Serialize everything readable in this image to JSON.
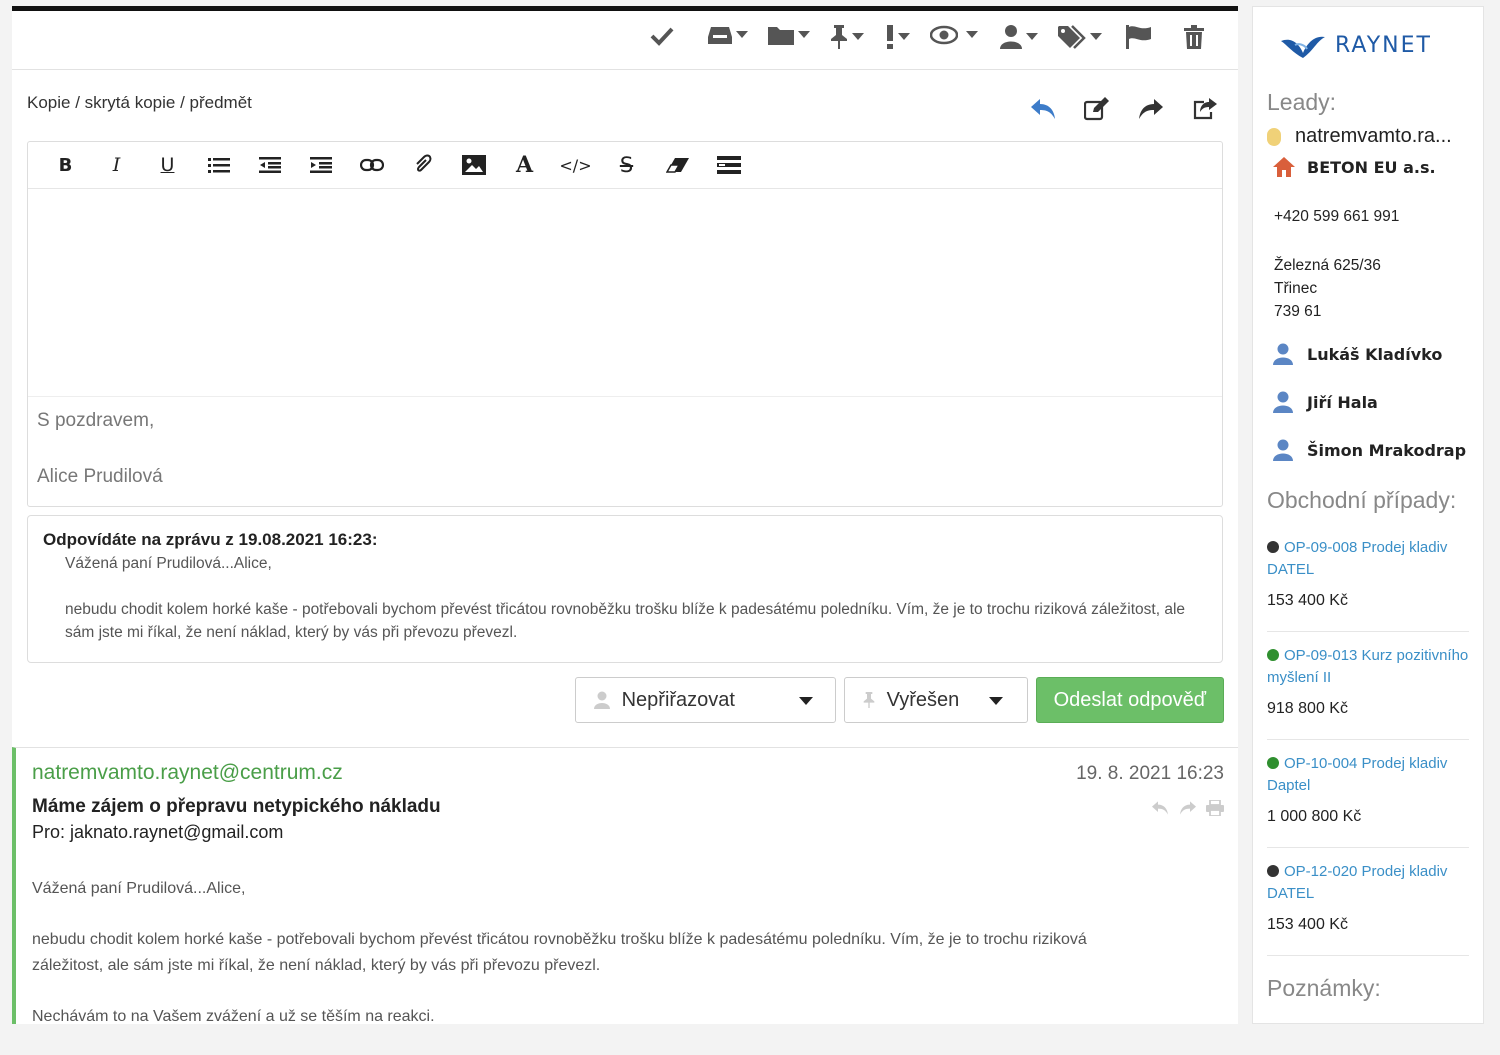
{
  "compose": {
    "recipients_label": "Kopie / skrytá kopie / předmět",
    "signature_line1": "S pozdravem,",
    "signature_line2": "Alice Prudilová"
  },
  "quote": {
    "title": "Odpovídáte na zprávu z 19.08.2021 16:23:",
    "greeting": "Vážená paní Prudilová...Alice,",
    "body": "nebudu chodit kolem horké kaše - potřebovali bychom převést třicátou rovnoběžku trošku blíže k padesátému poledníku. Vím, že je to trochu riziková záležitost, ale sám jste mi říkal, že není náklad, který by vás při převozu převezl."
  },
  "buttons": {
    "assign": "Nepřiřazovat",
    "status": "Vyřešen",
    "send": "Odeslat odpověď"
  },
  "message": {
    "from": "natremvamto.raynet@centrum.cz",
    "date": "19. 8. 2021 16:23",
    "subject": "Máme zájem o přepravu netypického nákladu",
    "to": "Pro: jaknato.raynet@gmail.com",
    "greeting": "Vážená paní Prudilová...Alice,",
    "body": "nebudu chodit kolem horké kaše - potřebovali bychom převést třicátou rovnoběžku trošku blíže k padesátému poledníku. Vím, že je to trochu riziková záležitost, ale sám jste mi říkal, že není náklad, který by vás při převozu převezl.",
    "closing": "Nechávám to na Vašem zvážení a už se těším na reakci."
  },
  "sidebar": {
    "logo": "RAYNET",
    "leads_title": "Leady:",
    "lead_email": "natremvamto.ra...",
    "company": "BETON EU a.s.",
    "phone": "+420 599 661 991",
    "address": [
      "Železná 625/36",
      "Třinec",
      "739 61"
    ],
    "persons": [
      "Lukáš Kladívko",
      "Jiří Hala",
      "Šimon Mrakodrap"
    ],
    "deals_title": "Obchodní případy:",
    "deals": [
      {
        "name": "OP-09-008 Prodej kladiv DATEL",
        "price": "153 400 Kč",
        "status_color": "#333333"
      },
      {
        "name": "OP-09-013 Kurz pozitivního myšlení II",
        "price": "918 800 Kč",
        "status_color": "#2f8f2f"
      },
      {
        "name": "OP-10-004 Prodej kladiv Daptel",
        "price": "1 000 800 Kč",
        "status_color": "#2f8f2f"
      },
      {
        "name": "OP-12-020 Prodej kladiv DATEL",
        "price": "153 400 Kč",
        "status_color": "#333333"
      }
    ],
    "notes_title": "Poznámky:"
  },
  "colors": {
    "accent_green": "#6cbf68",
    "link_blue": "#3a8fc7",
    "reply_blue": "#3d7cc9"
  }
}
